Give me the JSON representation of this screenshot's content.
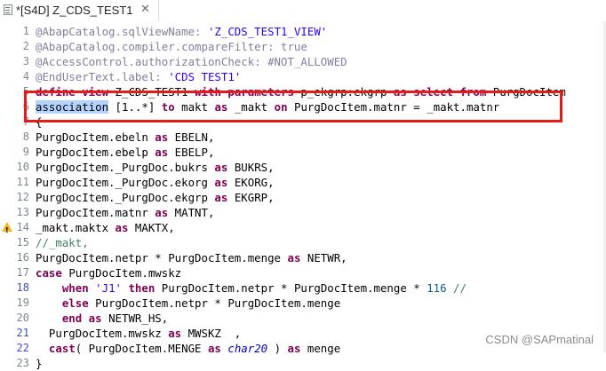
{
  "tab": {
    "title": "*[S4D] Z_CDS_TEST1",
    "close_glyph": "✕",
    "icon": "abap-file-icon"
  },
  "editor": {
    "lines": [
      {
        "num": "1",
        "tokens": [
          [
            "ann",
            "@AbapCatalog.sqlViewName: "
          ],
          [
            "str",
            "'Z_CDS_TEST1_VIEW'"
          ]
        ]
      },
      {
        "num": "2",
        "tokens": [
          [
            "ann",
            "@AbapCatalog.compiler.compareFilter: true"
          ]
        ]
      },
      {
        "num": "3",
        "tokens": [
          [
            "ann",
            "@AccessControl.authorizationCheck: #NOT_ALLOWED"
          ]
        ]
      },
      {
        "num": "4",
        "tokens": [
          [
            "ann",
            "@EndUserText.label: "
          ],
          [
            "str",
            "'CDS TEST1'"
          ]
        ]
      },
      {
        "num": "5",
        "tokens": [
          [
            "kw",
            "define view "
          ],
          [
            "op",
            "Z_CDS_TEST1 "
          ],
          [
            "kw",
            "with parameters "
          ],
          [
            "op",
            "p_ekgrp:ekgrp "
          ],
          [
            "kw",
            "as select from "
          ],
          [
            "op",
            "PurgDocItem"
          ]
        ]
      },
      {
        "num": "6",
        "tokens": [
          [
            "sel",
            "association"
          ],
          [
            "op",
            " [1..*] "
          ],
          [
            "kw",
            "to "
          ],
          [
            "op",
            "makt "
          ],
          [
            "kw",
            "as "
          ],
          [
            "op",
            "_makt "
          ],
          [
            "kw",
            "on "
          ],
          [
            "op",
            "PurgDocItem.matnr = _makt.matnr"
          ]
        ]
      },
      {
        "num": "7",
        "tokens": [
          [
            "op",
            "{"
          ]
        ]
      },
      {
        "num": "8",
        "tokens": [
          [
            "op",
            "PurgDocItem.ebeln "
          ],
          [
            "kw",
            "as "
          ],
          [
            "op",
            "EBELN,"
          ]
        ]
      },
      {
        "num": "9",
        "tokens": [
          [
            "op",
            "PurgDocItem.ebelp "
          ],
          [
            "kw",
            "as "
          ],
          [
            "op",
            "EBELP,"
          ]
        ]
      },
      {
        "num": "10",
        "tokens": [
          [
            "op",
            "PurgDocItem._PurgDoc.bukrs "
          ],
          [
            "kw",
            "as "
          ],
          [
            "op",
            "BUKRS,"
          ]
        ]
      },
      {
        "num": "11",
        "tokens": [
          [
            "op",
            "PurgDocItem._PurgDoc.ekorg "
          ],
          [
            "kw",
            "as "
          ],
          [
            "op",
            "EKORG,"
          ]
        ]
      },
      {
        "num": "12",
        "tokens": [
          [
            "op",
            "PurgDocItem._PurgDoc.ekgrp "
          ],
          [
            "kw",
            "as "
          ],
          [
            "op",
            "EKGRP,"
          ]
        ]
      },
      {
        "num": "13",
        "tokens": [
          [
            "op",
            "PurgDocItem.matnr "
          ],
          [
            "kw",
            "as "
          ],
          [
            "op",
            "MATNT,"
          ]
        ]
      },
      {
        "num": "14",
        "tokens": [
          [
            "op",
            "_makt.maktx "
          ],
          [
            "kw",
            "as "
          ],
          [
            "op",
            "MAKTX,"
          ]
        ],
        "warning": true
      },
      {
        "num": "15",
        "tokens": [
          [
            "cmt",
            "//_makt,"
          ]
        ]
      },
      {
        "num": "16",
        "tokens": [
          [
            "op",
            "PurgDocItem.netpr * PurgDocItem.menge "
          ],
          [
            "kw",
            "as "
          ],
          [
            "op",
            "NETWR,"
          ]
        ]
      },
      {
        "num": "17",
        "tokens": [
          [
            "kw",
            "case "
          ],
          [
            "op",
            "PurgDocItem.mwskz"
          ]
        ]
      },
      {
        "num": "18",
        "tokens": [
          [
            "op",
            "    "
          ],
          [
            "kw",
            "when "
          ],
          [
            "str",
            "'J1' "
          ],
          [
            "kw",
            "then "
          ],
          [
            "op",
            "PurgDocItem.netpr * PurgDocItem.menge * "
          ],
          [
            "num",
            "116 "
          ],
          [
            "cmt",
            "//"
          ]
        ],
        "hl": true
      },
      {
        "num": "19",
        "tokens": [
          [
            "op",
            "    "
          ],
          [
            "kw",
            "else "
          ],
          [
            "op",
            "PurgDocItem.netpr * PurgDocItem.menge"
          ]
        ]
      },
      {
        "num": "20",
        "tokens": [
          [
            "op",
            "    "
          ],
          [
            "kw",
            "end as "
          ],
          [
            "op",
            "NETWR_HS,"
          ]
        ]
      },
      {
        "num": "21",
        "tokens": [
          [
            "op",
            "  PurgDocItem.mwskz "
          ],
          [
            "kw",
            "as "
          ],
          [
            "op",
            "MWSKZ  ,"
          ]
        ],
        "hl": true
      },
      {
        "num": "22",
        "tokens": [
          [
            "op",
            "  "
          ],
          [
            "kw",
            "cast"
          ],
          [
            "op",
            "( PurgDocItem.MENGE "
          ],
          [
            "kw",
            "as "
          ],
          [
            "ital",
            "char20 "
          ],
          [
            "op",
            ") "
          ],
          [
            "kw",
            "as "
          ],
          [
            "op",
            "menge"
          ]
        ],
        "hl": true
      },
      {
        "num": "23",
        "tokens": [
          [
            "op",
            "}"
          ]
        ]
      }
    ]
  },
  "watermark": "CSDN @SAPmatinal",
  "colors": {
    "annotation": "#7f7f9f",
    "keyword": "#7f0055",
    "string": "#2a00ff",
    "comment": "#3f7f5f",
    "selection": "#b4d4ff",
    "highlight_box": "#e31b1b"
  }
}
